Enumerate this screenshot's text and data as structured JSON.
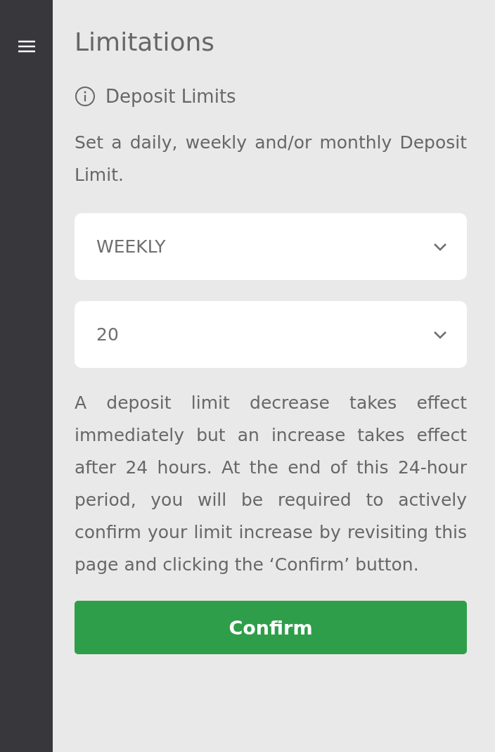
{
  "title": "Limitations",
  "section": {
    "heading": "Deposit Limits"
  },
  "intro": "Set a daily, weekly and/or monthly Deposit Limit.",
  "dropdowns": [
    {
      "value": "WEEKLY"
    },
    {
      "value": "20"
    }
  ],
  "notice": "A deposit limit decrease takes effect immediately but an increase takes effect after 24 hours. At the end of this 24-hour period, you will be required to actively confirm your limit increase by revisiting this page and clicking the ‘Confirm’ button.",
  "button": "Confirm"
}
